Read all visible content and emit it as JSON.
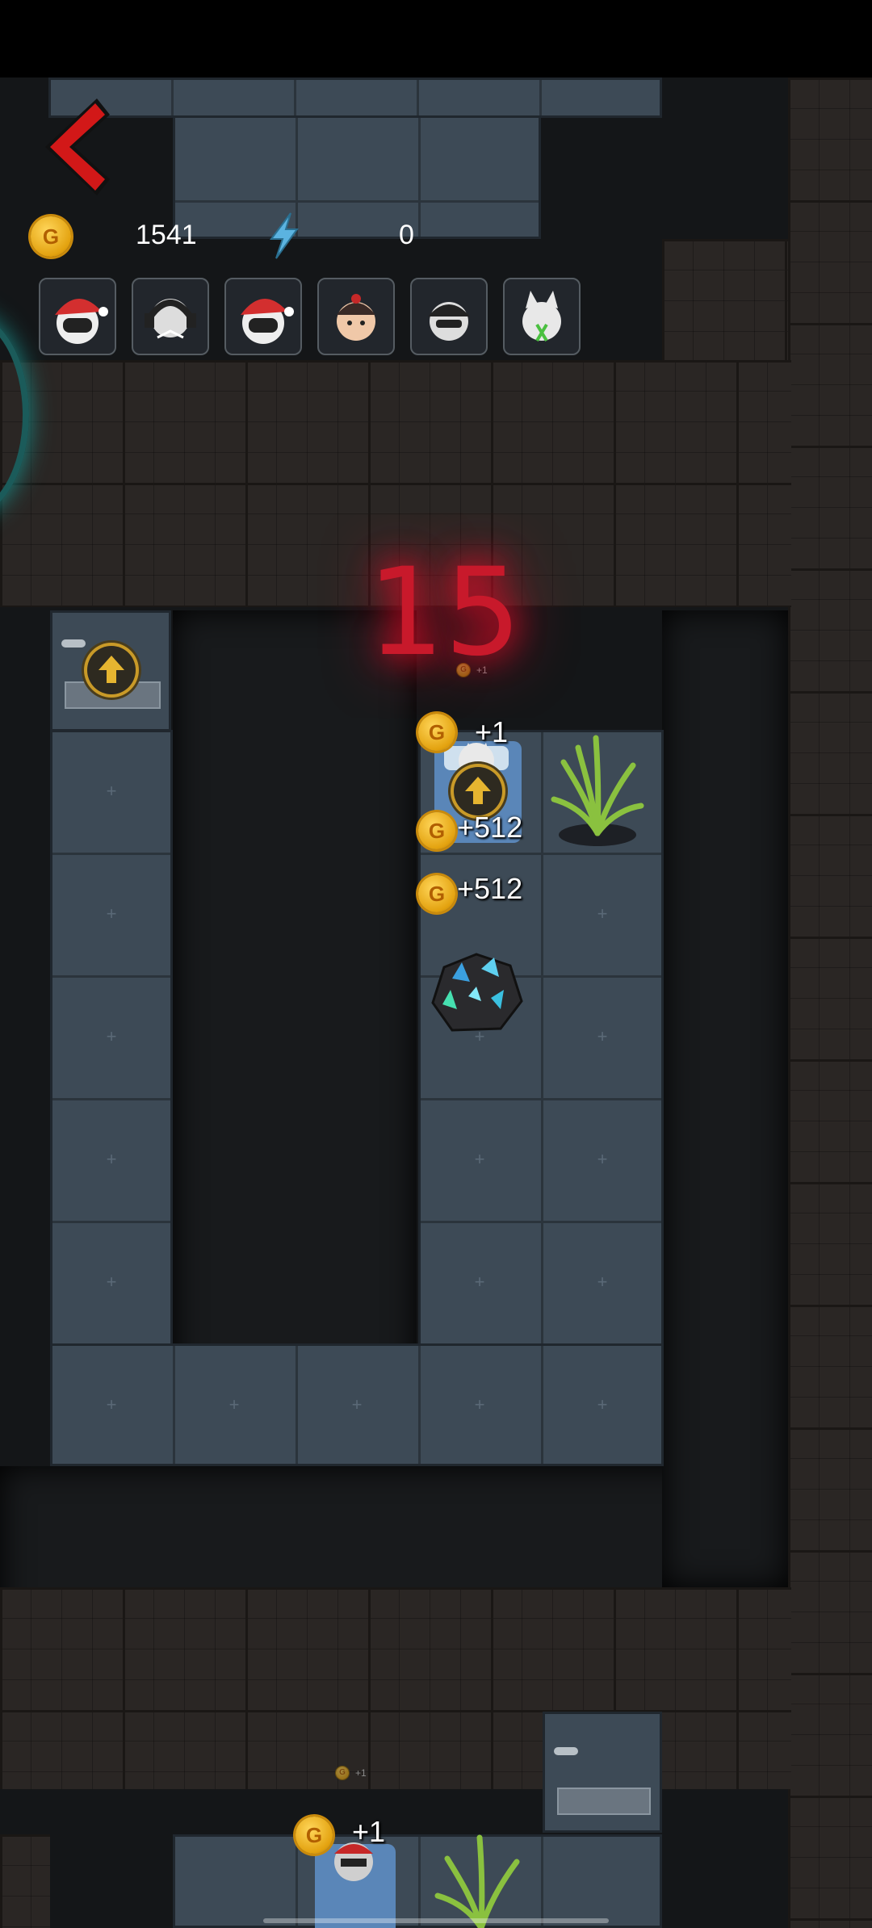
{
  "hud": {
    "coins": "1541",
    "energy": "0",
    "coin_icon": "gold-coin-icon",
    "energy_icon": "lightning-icon",
    "back_icon": "back-chevron-icon"
  },
  "characters": [
    {
      "name": "santa-hat-character",
      "color": "#d32f2f"
    },
    {
      "name": "headphone-character",
      "color": "#555555"
    },
    {
      "name": "santa-hat-character-2",
      "color": "#d32f2f"
    },
    {
      "name": "girl-character",
      "color": "#e8b090"
    },
    {
      "name": "dark-hair-character",
      "color": "#333333"
    },
    {
      "name": "cat-mask-character",
      "color": "#dddddd"
    }
  ],
  "countdown": "15",
  "gains": {
    "bed_top": "+1",
    "plant_top": "+512",
    "ore": "+512",
    "bed_bottom": "+1",
    "faint_top": "+1",
    "faint_bottom": "+1"
  },
  "coin_letter": "G",
  "colors": {
    "accent_red": "#c8192b",
    "gold": "#e3a20f",
    "floor": "#3d4a56",
    "wall": "#2a2624"
  }
}
